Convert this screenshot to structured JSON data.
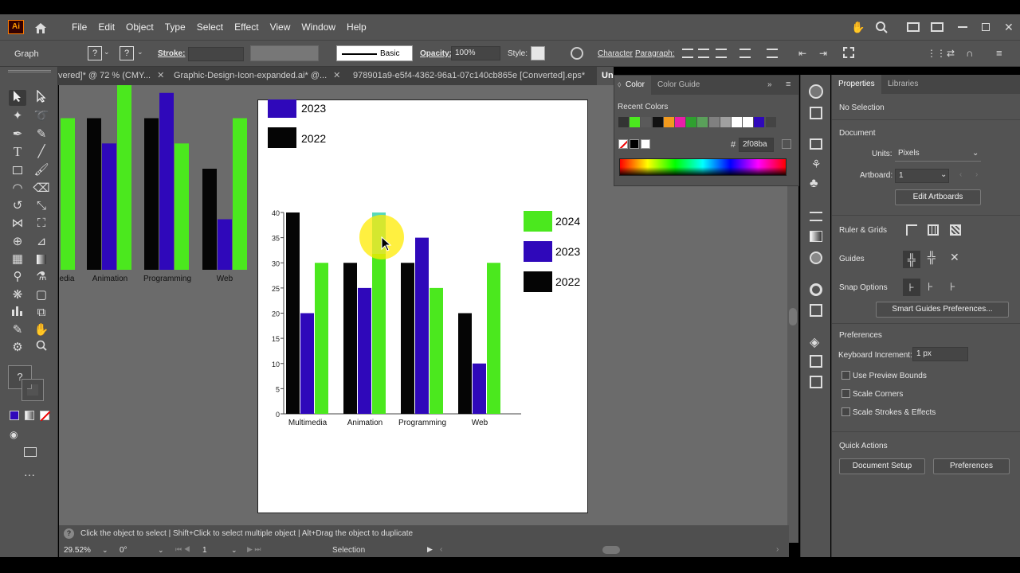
{
  "app": {
    "logo": "Ai"
  },
  "menu": [
    "File",
    "Edit",
    "Object",
    "Type",
    "Select",
    "Effect",
    "View",
    "Window",
    "Help"
  ],
  "control_bar": {
    "selection_type": "Graph",
    "stroke_label": "Stroke:",
    "brush_label": "Basic",
    "opacity_label": "Opacity:",
    "opacity_value": "100%",
    "style_label": "Style:",
    "character_label": "Character",
    "paragraph_label": "Paragraph:"
  },
  "tabs": [
    {
      "label": "vered]* @ 72 % (CMY..."
    },
    {
      "label": "Graphic-Design-Icon-expanded.ai* @..."
    },
    {
      "label": "978901a9-e5f4-4362-96a1-07c140cb865e [Converted].eps*"
    },
    {
      "label": "Un"
    }
  ],
  "color_panel": {
    "tab_color": "Color",
    "tab_guide": "Color Guide",
    "recent_label": "Recent Colors",
    "hex_symbol": "#",
    "hex_value": "2f08ba",
    "recent_colors": [
      "#333333",
      "#4be81e",
      "#5a5a5a",
      "#111111",
      "#f29a1e",
      "#e81ea8",
      "#2fa02f",
      "#5aa05a",
      "#808080",
      "#a0a0a0",
      "#ffffff",
      "#ffffff",
      "#2f08ba",
      "#444444"
    ]
  },
  "properties": {
    "tab_properties": "Properties",
    "tab_libraries": "Libraries",
    "selection": "No Selection",
    "document_label": "Document",
    "units_label": "Units:",
    "units_value": "Pixels",
    "artboard_label": "Artboard:",
    "artboard_value": "1",
    "edit_artboards": "Edit Artboards",
    "ruler_grids": "Ruler & Grids",
    "guides": "Guides",
    "snap_options": "Snap Options",
    "smart_guides_button": "Smart Guides Preferences...",
    "preferences_label": "Preferences",
    "keyboard_increment_label": "Keyboard Increment:",
    "keyboard_increment_value": "1 px",
    "use_preview_bounds": "Use Preview Bounds",
    "scale_corners": "Scale Corners",
    "scale_strokes": "Scale Strokes & Effects",
    "quick_actions": "Quick Actions",
    "document_setup": "Document Setup",
    "preferences_button": "Preferences"
  },
  "status": {
    "hint": "Click the object to select  |  Shift+Click to select multiple object  |  Alt+Drag the object to duplicate",
    "zoom": "29.52%",
    "rotation": "0°",
    "artboard": "1",
    "tool": "Selection"
  },
  "colors": {
    "y2024": "#4be81e",
    "y2023": "#2f08ba",
    "y2022": "#050505"
  },
  "chart_data": [
    {
      "type": "bar",
      "categories": [
        "Multimedia",
        "Animation",
        "Programming",
        "Web"
      ],
      "series": [
        {
          "name": "2022",
          "values": [
            40,
            30,
            30,
            20
          ]
        },
        {
          "name": "2023",
          "values": [
            20,
            25,
            35,
            10
          ]
        },
        {
          "name": "2024",
          "values": [
            30,
            40,
            25,
            30
          ]
        }
      ],
      "ylim": [
        0,
        40
      ],
      "yticks": [
        "0",
        "5",
        "10",
        "15",
        "20",
        "25",
        "30",
        "35",
        "40"
      ],
      "legend": "right",
      "legend_labels": [
        "2024",
        "2023",
        "2022"
      ]
    },
    {
      "type": "bar",
      "categories": [
        "edia",
        "Animation",
        "Programming",
        "Web"
      ],
      "series": [
        {
          "name": "2022",
          "values": [
            null,
            30,
            30,
            20
          ]
        },
        {
          "name": "2023",
          "values": [
            null,
            25,
            35,
            10
          ]
        },
        {
          "name": "2024",
          "values": [
            30,
            40,
            25,
            30
          ]
        }
      ],
      "ylim": [
        0,
        40
      ]
    }
  ],
  "legend_top": [
    "2023",
    "2022"
  ]
}
